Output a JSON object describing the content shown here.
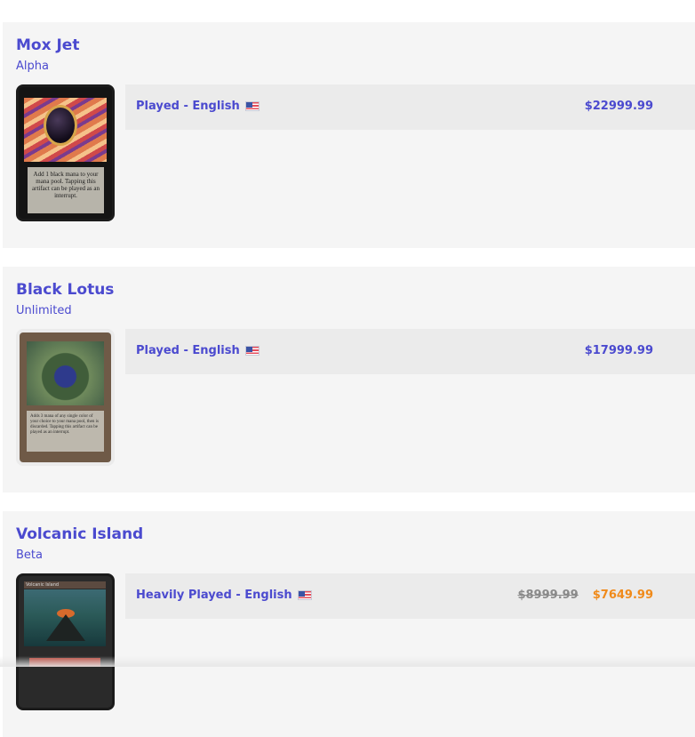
{
  "colors": {
    "title": "#4b4acf",
    "sale_price": "#f08a1a",
    "strike_price": "#8a8a8a",
    "card_bg": "#f5f5f5",
    "offer_bg": "#ebebeb"
  },
  "listings": [
    {
      "name": "Mox Jet",
      "set": "Alpha",
      "condition": "Played - English",
      "flag_icon": "us-flag-icon",
      "price": "$22999.99",
      "card_text": "Add 1 black mana to your mana pool. Tapping this artifact can be played as an interrupt."
    },
    {
      "name": "Black Lotus",
      "set": "Unlimited",
      "condition": "Played - English",
      "flag_icon": "us-flag-icon",
      "price": "$17999.99",
      "card_text": "Adds 3 mana of any single color of your choice to your mana pool, then is discarded. Tapping this artifact can be played as an interrupt."
    },
    {
      "name": "Volcanic Island",
      "set": "Beta",
      "condition": "Heavily Played - English",
      "flag_icon": "us-flag-icon",
      "original_price": "$8999.99",
      "sale_price": "$7649.99",
      "card_title": "Volcanic Island"
    }
  ]
}
